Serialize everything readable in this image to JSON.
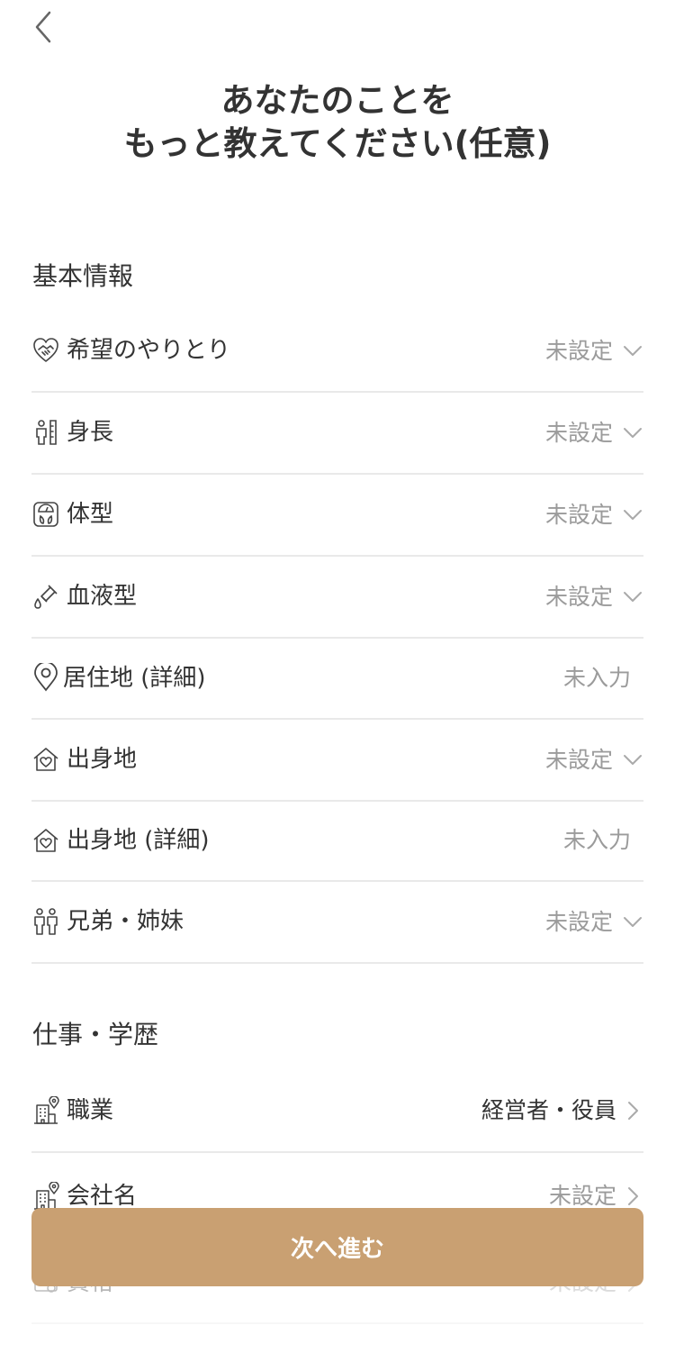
{
  "header": {
    "back_icon": "chevron-left-icon",
    "title_line1": "あなたのことを",
    "title_line2": "もっと教えてください(任意)"
  },
  "basic": {
    "section_title": "基本情報",
    "items": [
      {
        "icon": "handshake-heart-icon",
        "label": "希望のやりとり",
        "value": "未設定",
        "control": "dropdown"
      },
      {
        "icon": "height-person-icon",
        "label": "身長",
        "value": "未設定",
        "control": "dropdown"
      },
      {
        "icon": "body-scale-icon",
        "label": "体型",
        "value": "未設定",
        "control": "dropdown"
      },
      {
        "icon": "blood-test-tube-icon",
        "label": "血液型",
        "value": "未設定",
        "control": "dropdown"
      },
      {
        "icon": "location-pin-icon",
        "label": "居住地 (詳細)",
        "value": "未入力",
        "control": "text"
      },
      {
        "icon": "home-heart-icon",
        "label": "出身地",
        "value": "未設定",
        "control": "dropdown"
      },
      {
        "icon": "home-heart-icon",
        "label": "出身地 (詳細)",
        "value": "未入力",
        "control": "text"
      },
      {
        "icon": "siblings-icon",
        "label": "兄弟・姉妹",
        "value": "未設定",
        "control": "dropdown"
      }
    ]
  },
  "work": {
    "section_title": "仕事・学歴",
    "items": [
      {
        "icon": "building-pin-icon",
        "label": "職業",
        "value": "経営者・役員",
        "control": "link"
      },
      {
        "icon": "building-pin-icon",
        "label": "会社名",
        "value": "未設定",
        "control": "link"
      },
      {
        "icon": "certificate-icon",
        "label": "資格",
        "value": "未設定",
        "control": "link"
      }
    ]
  },
  "footer": {
    "next_label": "次へ進む"
  },
  "colors": {
    "accent": "#c9a072",
    "text": "#333333",
    "muted": "#9b9b9b",
    "divider": "#e9e9e9"
  }
}
